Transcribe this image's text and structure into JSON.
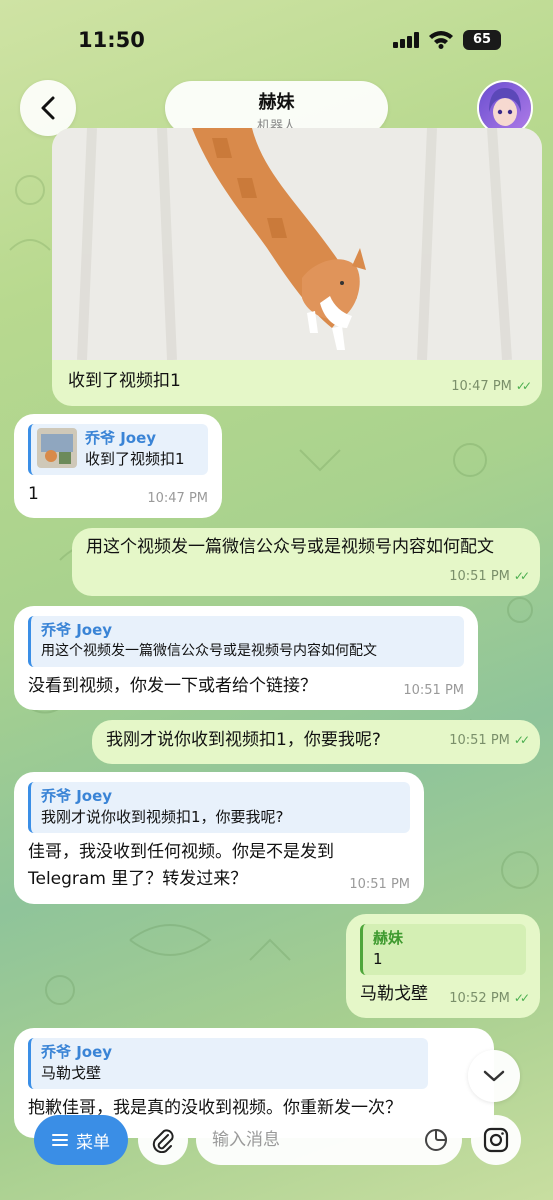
{
  "status_bar": {
    "time": "11:50",
    "battery": "65"
  },
  "header": {
    "title": "赫妹",
    "subtitle": "机器人"
  },
  "messages": [
    {
      "text": "收到了视频扣1",
      "time": "10:47 PM"
    },
    {
      "reply_name": "乔爷 Joey",
      "reply_text": "收到了视频扣1",
      "text": "1",
      "time": "10:47 PM"
    },
    {
      "text": "用这个视频发一篇微信公众号或是视频号内容如何配文",
      "time": "10:51 PM"
    },
    {
      "reply_name": "乔爷 Joey",
      "reply_text": "用这个视频发一篇微信公众号或是视频号内容如何配文",
      "text": "没看到视频，你发一下或者给个链接？",
      "time": "10:51 PM"
    },
    {
      "text": "我刚才说你收到视频扣1，你要我呢?",
      "time": "10:51 PM"
    },
    {
      "reply_name": "乔爷 Joey",
      "reply_text": "我刚才说你收到视频扣1，你要我呢?",
      "text": "佳哥，我没收到任何视频。你是不是发到 Telegram 里了？转发过来？",
      "time": "10:51 PM"
    },
    {
      "reply_name": "赫妹",
      "reply_text": "1",
      "text": "马勒戈壁",
      "time": "10:52 PM"
    },
    {
      "reply_name": "乔爷 Joey",
      "reply_text": "马勒戈壁",
      "text": "抱歉佳哥，我是真的没收到视频。你重新发一次？"
    }
  ],
  "bottom_bar": {
    "menu_label": "菜单",
    "input_placeholder": "输入消息"
  },
  "colors": {
    "accent": "#3a8ee6",
    "outgoing_bubble": "#e5f7c8",
    "incoming_bubble": "#ffffff",
    "read_ticks": "#4caf50"
  }
}
